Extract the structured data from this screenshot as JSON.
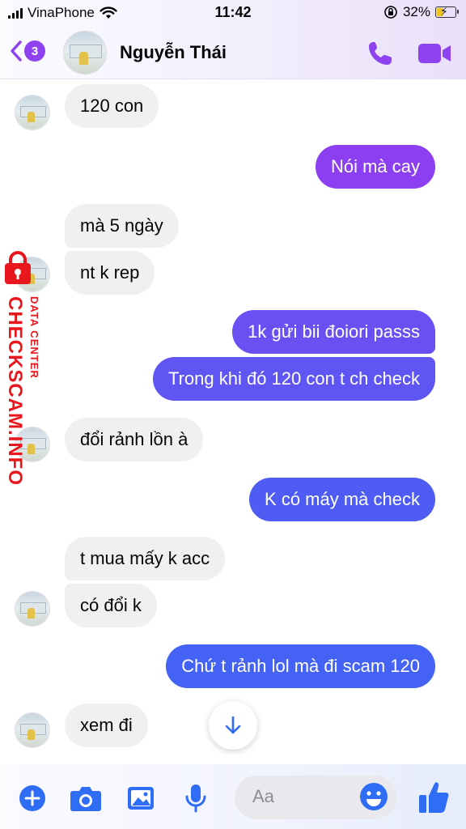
{
  "status_bar": {
    "carrier": "VinaPhone",
    "time": "11:42",
    "battery": "32%"
  },
  "header": {
    "unread_count": "3",
    "contact_name": "Nguyễn Thái"
  },
  "messages": [
    {
      "side": "in",
      "text": "120 con"
    },
    {
      "side": "out",
      "text": "Nói mà cay"
    },
    {
      "side": "in",
      "text": "mà 5 ngày"
    },
    {
      "side": "in",
      "text": "nt k rep"
    },
    {
      "side": "out",
      "text": "1k gửi bii đoiori passs"
    },
    {
      "side": "out",
      "text": "Trong khi đó 120 con t ch check"
    },
    {
      "side": "in",
      "text": "đổi rảnh lồn à"
    },
    {
      "side": "out",
      "text": "K có máy mà check"
    },
    {
      "side": "in",
      "text": "t mua mấy k acc"
    },
    {
      "side": "in",
      "text": "có đổi k"
    },
    {
      "side": "out",
      "text": "Chứ t rảnh lol mà đi scam 120"
    },
    {
      "side": "in",
      "text": "xem đi"
    }
  ],
  "watermark": {
    "main": "CHECKSCAM.INFO",
    "sub": "DATA CENTER"
  },
  "composer": {
    "placeholder": "Aa"
  },
  "colors": {
    "accent": "#8e42f0",
    "bubble_out_top": "#8b3ff0",
    "bubble_out_bottom": "#3f64f4",
    "bubble_in": "#f0f0f0",
    "watermark": "#e8171d",
    "composer_icon": "#2f6df5"
  },
  "icons": [
    "back-chevron-icon",
    "phone-icon",
    "video-camera-icon",
    "arrow-down-icon",
    "plus-icon",
    "camera-icon",
    "image-icon",
    "microphone-icon",
    "emoji-icon",
    "thumbs-up-icon",
    "lock-icon"
  ]
}
